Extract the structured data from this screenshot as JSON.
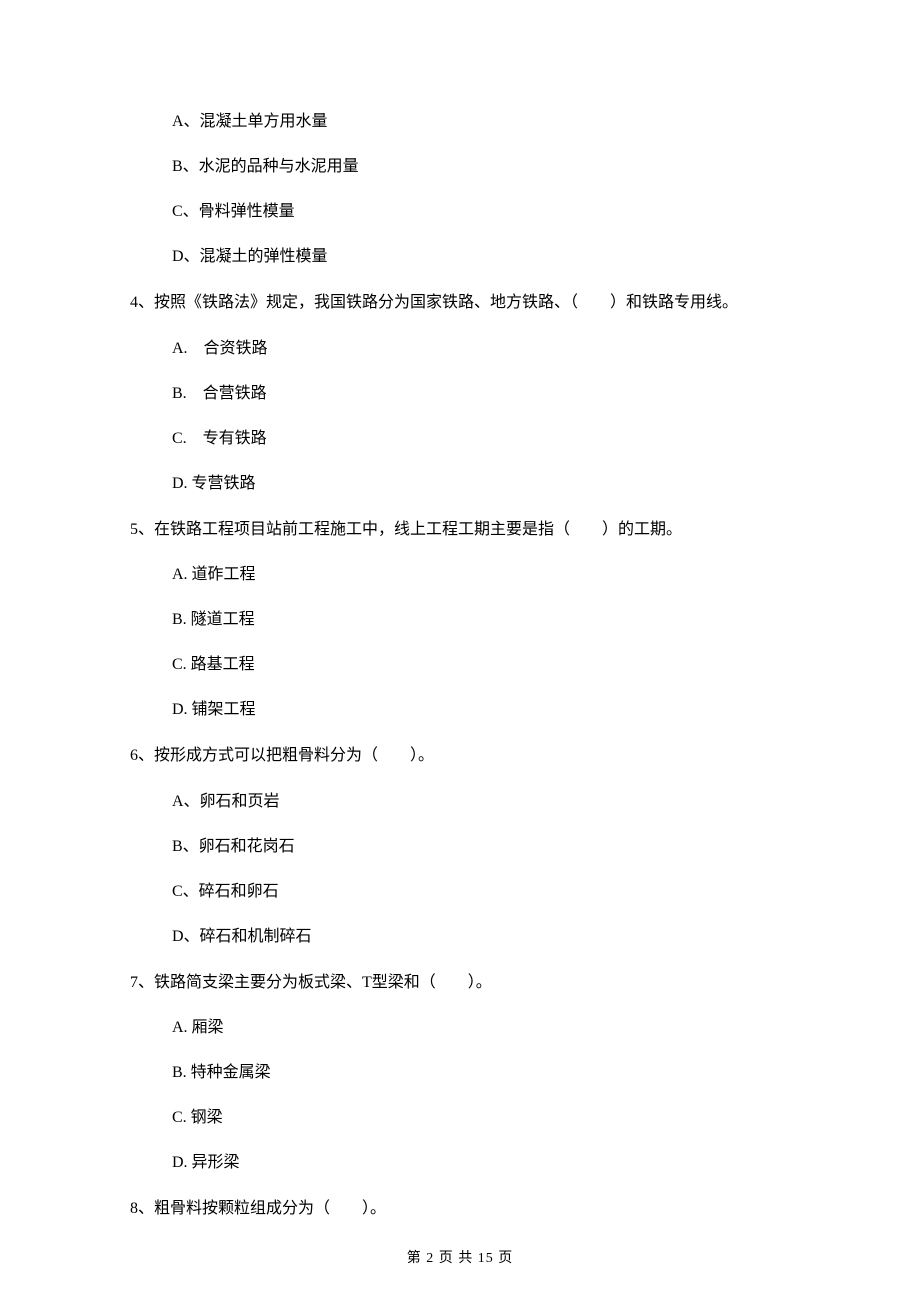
{
  "q3_options": {
    "a": "A、混凝土单方用水量",
    "b": "B、水泥的品种与水泥用量",
    "c": "C、骨料弹性模量",
    "d": "D、混凝土的弹性模量"
  },
  "q4": {
    "stem": "4、按照《铁路法》规定，我国铁路分为国家铁路、地方铁路、（　　）和铁路专用线。",
    "a": "A.　合资铁路",
    "b": "B.　合营铁路",
    "c": "C.　专有铁路",
    "d": "D. 专营铁路"
  },
  "q5": {
    "stem": "5、在铁路工程项目站前工程施工中，线上工程工期主要是指（　　）的工期。",
    "a": "A. 道砟工程",
    "b": "B. 隧道工程",
    "c": "C. 路基工程",
    "d": "D. 铺架工程"
  },
  "q6": {
    "stem": "6、按形成方式可以把粗骨料分为（　　）。",
    "a": "A、卵石和页岩",
    "b": "B、卵石和花岗石",
    "c": "C、碎石和卵石",
    "d": "D、碎石和机制碎石"
  },
  "q7": {
    "stem": "7、铁路简支梁主要分为板式梁、T型梁和（　　）。",
    "a": "A. 厢梁",
    "b": "B. 特种金属梁",
    "c": "C. 钢梁",
    "d": "D. 异形梁"
  },
  "q8": {
    "stem": "8、粗骨料按颗粒组成分为（　　）。"
  },
  "footer": "第 2 页 共 15 页"
}
